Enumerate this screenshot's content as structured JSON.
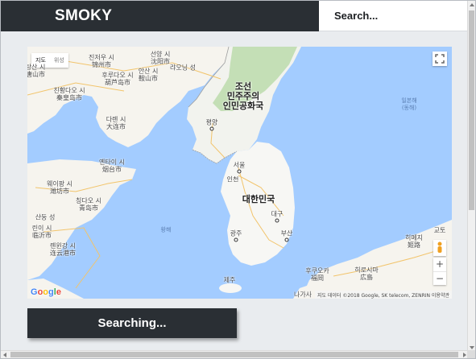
{
  "header": {
    "brand": "SMOKY",
    "search_placeholder": "Search..."
  },
  "map": {
    "type_controls": [
      "지도",
      "위성"
    ],
    "google_logo": "Google",
    "attribution": "지도 데이터 ©2018 Google, SK telecom, ZENRIN   이용약관",
    "zoom_in": "+",
    "zoom_out": "−",
    "labels": {
      "north_korea": "조선\n민주주의\n인민공화국",
      "south_korea": "대한민국",
      "pyongyang": "평양",
      "seoul": "서울",
      "incheon": "인천",
      "daegu": "대구",
      "gwangju": "광주",
      "busan": "부산",
      "jeju": "제주",
      "shenyang": "선양 시\n沈阳市",
      "anshan": "안산 시\n鞍山市",
      "jinzhou": "진저우 시\n锦州市",
      "huludao": "후루다오 시\n葫芦岛市",
      "qinhuangdao": "친황다오 시\n秦皇岛市",
      "tangshan": "탕산 시\n唐山市",
      "dalian": "다롄 시\n大连市",
      "yantai": "옌타이 시\n烟台市",
      "weifang": "웨이팡 시\n潍坊市",
      "qingdao": "칭다오 시\n青岛市",
      "shandong": "산둥 성",
      "linyi": "린이 시\n临沂市",
      "lianyungang": "롄윈강 시\n连云港市",
      "liaoning": "랴오닝 성",
      "hiroshima": "히로시마\n広島",
      "fukuoka": "후쿠오카\n福岡",
      "himeji": "히메지\n姬路",
      "kyoto": "교토",
      "nagasaki": "나가사",
      "east_sea": "일본해\n(동해)",
      "yellow_sea": "황해"
    }
  },
  "button": {
    "label": "Searching..."
  },
  "colors": {
    "header_bg": "#2a2f34",
    "page_bg": "#e9ecef",
    "water": "#a3ccff",
    "land": "#f6f4ee",
    "mountain": "#b8d9a8"
  }
}
